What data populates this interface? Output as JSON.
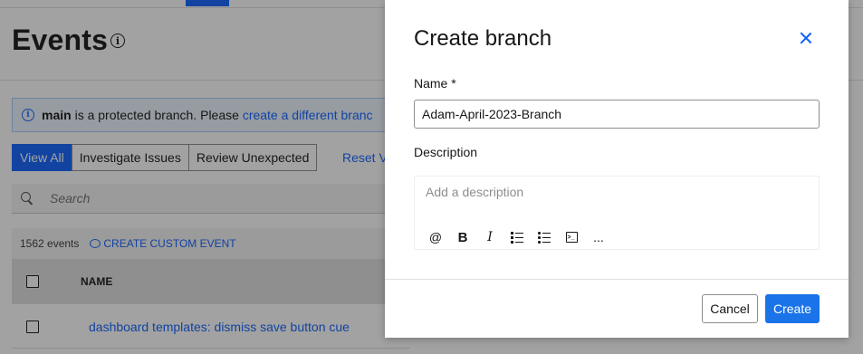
{
  "page": {
    "title": "Events",
    "notice": {
      "branch": "main",
      "text": "is a protected branch. Please",
      "link": "create a different branc"
    },
    "view_filters": [
      "View All",
      "Investigate Issues",
      "Review Unexpected"
    ],
    "reset_label": "Reset V",
    "search_placeholder": "Search",
    "events_count": "1562 events",
    "create_custom_event": "CREATE CUSTOM EVENT",
    "table": {
      "column_name": "NAME",
      "rows": [
        "dashboard templates: dismiss save button cue"
      ]
    }
  },
  "modal": {
    "title": "Create branch",
    "name_label": "Name *",
    "name_value": "Adam-April-2023-Branch",
    "description_label": "Description",
    "description_placeholder": "Add a description",
    "toolbar": {
      "mention": "@",
      "bold": "B",
      "italic": "I",
      "more": "..."
    },
    "cancel_label": "Cancel",
    "create_label": "Create"
  },
  "colors": {
    "accent": "#0f62fe",
    "primary_button": "#1a73e8",
    "overlay": "rgba(22,22,22,0.4)"
  }
}
